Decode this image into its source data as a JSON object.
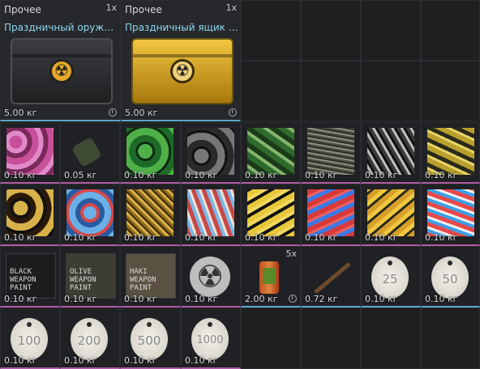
{
  "inventory": {
    "cases": [
      {
        "category": "Прочее",
        "qty": "1x",
        "title": "Праздничный оружей...",
        "weight": "5.00 кг",
        "style": "black"
      },
      {
        "category": "Прочее",
        "qty": "1x",
        "title": "Праздничный ящик с...",
        "weight": "5.00 кг",
        "style": "gold"
      }
    ],
    "row2": [
      {
        "weight": "0.10 кг",
        "pattern": [
          "#c8509a",
          "#e08ac8",
          "#7a2a5a"
        ]
      },
      {
        "weight": "0.05 кг",
        "icon": "grenade-icon"
      },
      {
        "weight": "0.10 кг",
        "pattern": [
          "#1e6a28",
          "#4fb04a",
          "#0d2a10"
        ]
      },
      {
        "weight": "0.10 кг",
        "pattern": [
          "#2a2a2a",
          "#777777",
          "#111111"
        ]
      },
      {
        "weight": "0.10 кг",
        "pattern": [
          "#2f6b2c",
          "#86b56e",
          "#1b3a18"
        ]
      },
      {
        "weight": "0.10 кг",
        "pattern": [
          "#4a4f40",
          "#8a8f80",
          "#2c2f28"
        ]
      },
      {
        "weight": "0.10 кг",
        "pattern": [
          "#3a3a3a",
          "#bdbdbd",
          "#111111"
        ]
      },
      {
        "weight": "0.10 кг",
        "pattern": [
          "#b99f2c",
          "#e7d36a",
          "#2a2a1a"
        ]
      }
    ],
    "row3": [
      {
        "weight": "0.10 кг",
        "pattern": [
          "#2a1a0a",
          "#d8b14a",
          "#111111"
        ]
      },
      {
        "weight": "0.10 кг",
        "pattern": [
          "#d84848",
          "#6ab0e8",
          "#2a5aa0"
        ]
      },
      {
        "weight": "0.10 кг",
        "pattern": [
          "#8c6a1a",
          "#d8b04a",
          "#3a2a0a"
        ]
      },
      {
        "weight": "0.10 кг",
        "pattern": [
          "#c84848",
          "#7ab8e8",
          "#f0e0d0"
        ]
      },
      {
        "weight": "0.10 кг",
        "pattern": [
          "#e8c83a",
          "#111111",
          "#f0d860"
        ]
      },
      {
        "weight": "0.10 кг",
        "pattern": [
          "#d83a3a",
          "#3a7ae8",
          "#f06060"
        ]
      },
      {
        "weight": "0.10 кг",
        "pattern": [
          "#d8a02a",
          "#2a2a1a",
          "#f0c840"
        ]
      },
      {
        "weight": "0.10 кг",
        "pattern": [
          "#e84848",
          "#3aa0e8",
          "#f0f0f0"
        ]
      }
    ],
    "row4": [
      {
        "weight": "0.10 кг",
        "paint_lines": [
          "BLACK",
          "WEAPON",
          "PAINT"
        ]
      },
      {
        "weight": "0.10 кг",
        "paint_lines": [
          "OLIVE",
          "WEAPON",
          "PAINT"
        ]
      },
      {
        "weight": "0.10 кг",
        "paint_lines": [
          "HAKI",
          "WEAPON",
          "PAINT"
        ]
      },
      {
        "weight": "0.10 кг",
        "icon": "radiation-icon"
      },
      {
        "weight": "2.00 кг",
        "qty": "5x",
        "icon": "can-icon"
      },
      {
        "weight": "0.72 кг",
        "icon": "stick-icon"
      },
      {
        "weight": "0.10 кг",
        "tag": "25"
      },
      {
        "weight": "0.10 кг",
        "tag": "50"
      }
    ],
    "row5": [
      {
        "weight": "0.10 кг",
        "tag": "100"
      },
      {
        "weight": "0.10 кг",
        "tag": "200"
      },
      {
        "weight": "0.10 кг",
        "tag": "500"
      },
      {
        "weight": "0.10 кг",
        "tag": "1000"
      }
    ]
  }
}
